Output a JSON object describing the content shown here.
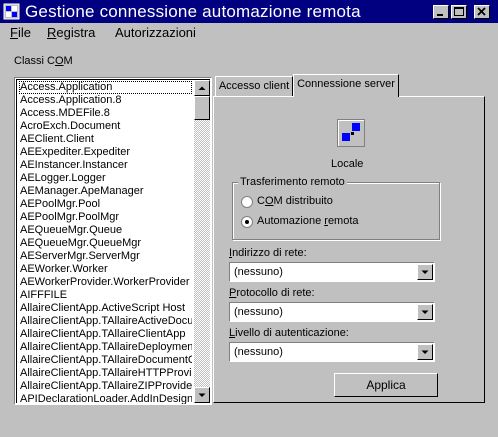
{
  "window": {
    "title": "Gestione connessione automazione remota",
    "icon": "remote-automation-app-icon",
    "controls": [
      "minimize-icon",
      "maximize-icon",
      "close-icon"
    ]
  },
  "menu": {
    "file_prefix": "F",
    "file_rest": "ile",
    "registra_prefix": "R",
    "registra_rest": "egistra",
    "autorizzazioni": "Autorizzazioni"
  },
  "classes": {
    "label_prefix": "Classi C",
    "label_u": "O",
    "label_rest": "M",
    "items": [
      "Access.Application",
      "Access.Application.8",
      "Access.MDEFile.8",
      "AcroExch.Document",
      "AEClient.Client",
      "AEExpediter.Expediter",
      "AEInstancer.Instancer",
      "AELogger.Logger",
      "AEManager.ApeManager",
      "AEPoolMgr.Pool",
      "AEPoolMgr.PoolMgr",
      "AEQueueMgr.Queue",
      "AEQueueMgr.QueueMgr",
      "AEServerMgr.ServerMgr",
      "AEWorker.Worker",
      "AEWorkerProvider.WorkerProvider",
      "AIFFFILE",
      "AllaireClientApp.ActiveScript Host",
      "AllaireClientApp.TAllaireActiveDocum",
      "AllaireClientApp.TAllaireClientApp",
      "AllaireClientApp.TAllaireDeploymentM",
      "AllaireClientApp.TAllaireDocumentCa",
      "AllaireClientApp.TAllaireHTTPProvide",
      "AllaireClientApp.TAllaireZIPProvider",
      "APIDeclarationLoader.AddInDesigne"
    ],
    "selected_index": 0
  },
  "tabs": {
    "accesso_client": "Accesso client",
    "connessione_server": "Connessione server",
    "active": "connessione_server"
  },
  "server": {
    "locale_label": "Locale",
    "icon": "local-computer-icon",
    "group_title": "Trasferimento remoto",
    "radio_com_prefix": "C",
    "radio_com_u": "O",
    "radio_com_rest": "M distribuito",
    "radio_auto_prefix": "Automazione ",
    "radio_auto_u": "r",
    "radio_auto_rest": "emota",
    "selected_transfer": "automazione_remota",
    "indirizzo_prefix": "",
    "indirizzo_u": "I",
    "indirizzo_rest": "ndirizzo di rete:",
    "indirizzo_value": "(nessuno)",
    "protocollo_prefix": "",
    "protocollo_u": "P",
    "protocollo_rest": "rotocollo di rete:",
    "protocollo_value": "(nessuno)",
    "livello_prefix": "",
    "livello_u": "L",
    "livello_rest": "ivello di autenticazione:",
    "livello_value": "(nessuno)",
    "apply_label": "Applica"
  }
}
